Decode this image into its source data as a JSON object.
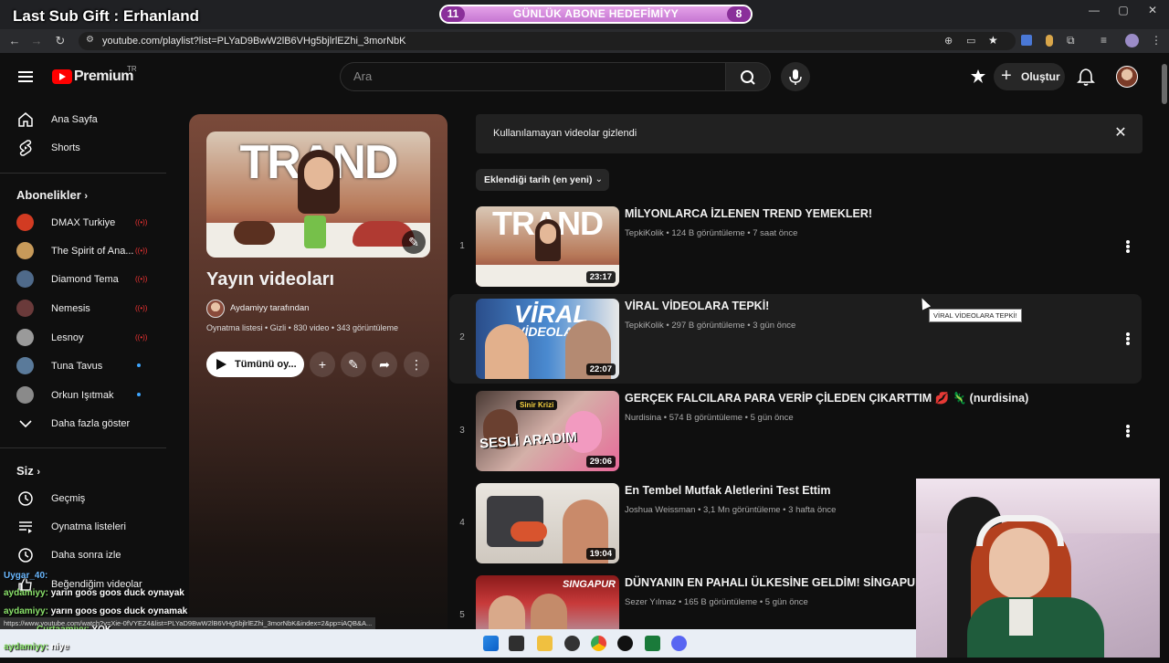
{
  "overlay": {
    "sub_gift": "Last Sub Gift : Erhanland",
    "goal": {
      "left": "11",
      "text": "GÜNLÜK ABONE HEDEFİMİYY",
      "right": "8"
    }
  },
  "browser": {
    "url": "youtube.com/playlist?list=PLYaD9BwW2lB6VHg5bjlrlEZhi_3morNbK",
    "status_url": "https://www.youtube.com/watch?v=Xie-0fVYEZ4&list=PLYaD9BwW2lB6VHg5bjlrlEZhi_3morNbK&index=2&pp=iAQB&A..."
  },
  "header": {
    "logo": "Premium",
    "logo_region": "TR",
    "search_placeholder": "Ara",
    "create_label": "Oluştur"
  },
  "sidebar": {
    "main": [
      {
        "label": "Ana Sayfa",
        "icon": "home-icon"
      },
      {
        "label": "Shorts",
        "icon": "shorts-icon"
      }
    ],
    "subs_heading": "Abonelikler",
    "subs": [
      {
        "label": "DMAX Turkiye",
        "state": "live",
        "color": "#d23b22"
      },
      {
        "label": "The Spirit of Ana...",
        "state": "live",
        "color": "#c79a5a"
      },
      {
        "label": "Diamond Tema",
        "state": "live",
        "color": "#4f6a8a"
      },
      {
        "label": "Nemesis",
        "state": "live",
        "color": "#6a3a3a"
      },
      {
        "label": "Lesnoy",
        "state": "live",
        "color": "#9a9a9a"
      },
      {
        "label": "Tuna Tavus",
        "state": "new",
        "color": "#5a7a9a"
      },
      {
        "label": "Orkun Işıtmak",
        "state": "new",
        "color": "#8a8a8a"
      }
    ],
    "show_more": "Daha fazla göster",
    "you_heading": "Siz",
    "you": [
      {
        "label": "Geçmiş",
        "icon": "history-icon"
      },
      {
        "label": "Oynatma listeleri",
        "icon": "playlists-icon"
      },
      {
        "label": "Daha sonra izle",
        "icon": "watch-later-icon"
      },
      {
        "label": "Beğendiğim videolar",
        "icon": "like-icon"
      }
    ]
  },
  "playlist": {
    "thumb_text": "TRAND",
    "title": "Yayın videoları",
    "owner": "Aydamiyy tarafından",
    "meta": "Oynatma listesi • Gizli • 830 video • 343 görüntüleme",
    "play_all": "Tümünü oy..."
  },
  "notice": "Kullanılamayan videolar gizlendi",
  "sort_label": "Eklendiği tarih (en yeni)",
  "videos": [
    {
      "index": "1",
      "title": "MİLYONLARCA İZLENEN TREND YEMEKLER!",
      "meta": "TepkiKolik • 124 B görüntüleme • 7 saat önce",
      "duration": "23:17"
    },
    {
      "index": "2",
      "title": "VİRAL VİDEOLARA TEPKİ!",
      "meta": "TepkiKolik • 297 B görüntüleme • 3 gün önce",
      "duration": "22:07"
    },
    {
      "index": "3",
      "title": "GERÇEK FALCILARA PARA VERİP ÇİLEDEN ÇIKARTTIM 💋 🦎 (nurdisina)",
      "meta": "Nurdisina • 574 B görüntüleme • 5 gün önce",
      "duration": "29:06"
    },
    {
      "index": "4",
      "title": "En Tembel Mutfak Aletlerini Test Ettim",
      "meta": "Joshua Weissman • 3,1 Mn görüntüleme • 3 hafta önce",
      "duration": "19:04"
    },
    {
      "index": "5",
      "title": "DÜNYANIN EN PAHALI ÜLKESİNE GELDİM! SİNGAPUR'DA",
      "meta": "Sezer Yılmaz • 165 B görüntüleme • 5 gün önce",
      "duration": ""
    }
  ],
  "thumb_texts": {
    "v2a": "VİRAL",
    "v2b": "VİDEOLAR",
    "v3a": "SESLİ ARADIM",
    "v3b": "Sinir Krizi",
    "v5": "SINGAPUR"
  },
  "tooltip": "VİRAL VİDEOLARA TEPKİ!",
  "chat": [
    {
      "user": "Uygar_40:",
      "text": ""
    },
    {
      "user": "aydamiyy:",
      "text": "yarın goos goos duck oynayak"
    },
    {
      "user": "aydamiyy:",
      "text": "yarın goos goos duck oynamak"
    },
    {
      "user": "Curtaamiyy:",
      "text": "YOK"
    },
    {
      "user": "aydamiyy:",
      "text": "niye"
    }
  ]
}
